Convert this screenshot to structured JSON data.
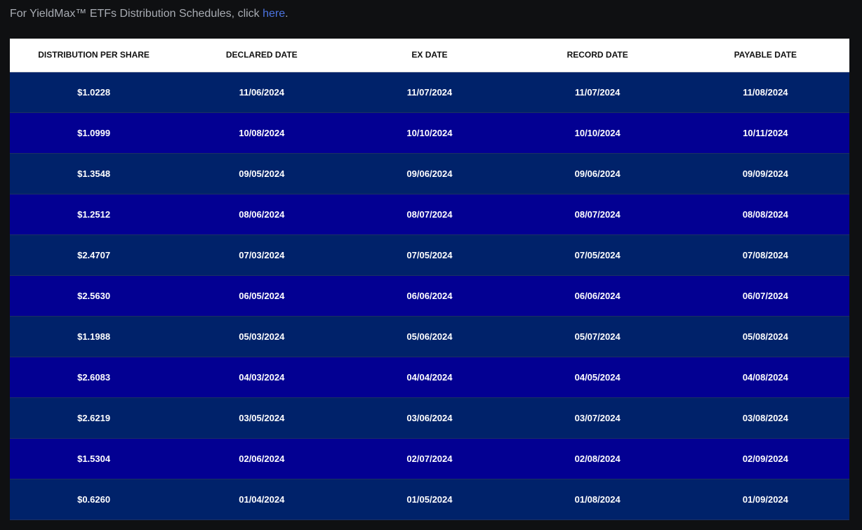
{
  "intro": {
    "prefix": "For YieldMax™ ETFs Distribution Schedules, click ",
    "link_label": "here",
    "suffix": "."
  },
  "colors": {
    "background": "#0f1012",
    "row_odd": "#00226a",
    "row_even": "#030092",
    "link": "#4b73e0"
  },
  "table": {
    "headers": [
      "DISTRIBUTION PER SHARE",
      "DECLARED DATE",
      "EX DATE",
      "RECORD DATE",
      "PAYABLE DATE"
    ],
    "rows": [
      [
        "$1.0228",
        "11/06/2024",
        "11/07/2024",
        "11/07/2024",
        "11/08/2024"
      ],
      [
        "$1.0999",
        "10/08/2024",
        "10/10/2024",
        "10/10/2024",
        "10/11/2024"
      ],
      [
        "$1.3548",
        "09/05/2024",
        "09/06/2024",
        "09/06/2024",
        "09/09/2024"
      ],
      [
        "$1.2512",
        "08/06/2024",
        "08/07/2024",
        "08/07/2024",
        "08/08/2024"
      ],
      [
        "$2.4707",
        "07/03/2024",
        "07/05/2024",
        "07/05/2024",
        "07/08/2024"
      ],
      [
        "$2.5630",
        "06/05/2024",
        "06/06/2024",
        "06/06/2024",
        "06/07/2024"
      ],
      [
        "$1.1988",
        "05/03/2024",
        "05/06/2024",
        "05/07/2024",
        "05/08/2024"
      ],
      [
        "$2.6083",
        "04/03/2024",
        "04/04/2024",
        "04/05/2024",
        "04/08/2024"
      ],
      [
        "$2.6219",
        "03/05/2024",
        "03/06/2024",
        "03/07/2024",
        "03/08/2024"
      ],
      [
        "$1.5304",
        "02/06/2024",
        "02/07/2024",
        "02/08/2024",
        "02/09/2024"
      ],
      [
        "$0.6260",
        "01/04/2024",
        "01/05/2024",
        "01/08/2024",
        "01/09/2024"
      ]
    ]
  }
}
